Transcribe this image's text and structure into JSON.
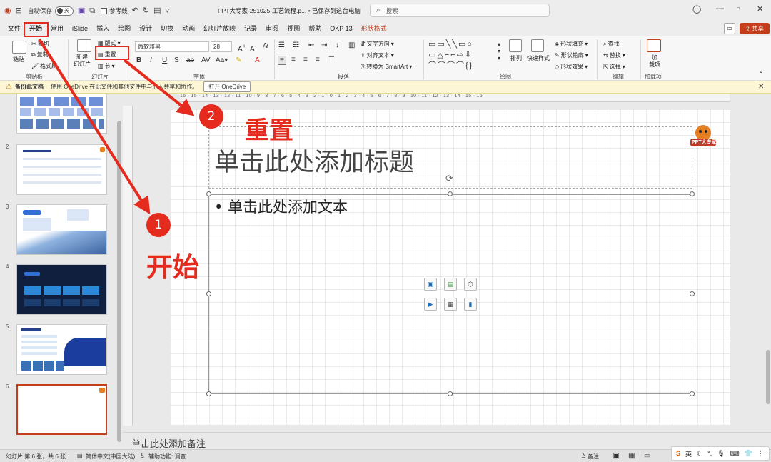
{
  "titlebar": {
    "autosave_label": "自动保存",
    "autosave_state": "关",
    "ref_mode_label": "参考线",
    "doc_title": "PPT大专家-251025-工艺流程.p... • 已保存到这台电脑",
    "search_placeholder": "搜索"
  },
  "tabs": [
    "文件",
    "开始",
    "常用",
    "iSlide",
    "插入",
    "绘图",
    "设计",
    "切换",
    "动画",
    "幻灯片放映",
    "记录",
    "审阅",
    "视图",
    "帮助",
    "OKP 13",
    "形状格式"
  ],
  "share_label": "共享",
  "ribbon": {
    "clipboard": {
      "paste": "粘贴",
      "cut": "剪切",
      "copy": "复制",
      "format_painter": "格式刷",
      "label": "剪贴板"
    },
    "slides": {
      "new_slide": "新建\n幻灯片",
      "layout": "版式",
      "reset": "重置",
      "section": "节",
      "label": "幻灯片"
    },
    "font": {
      "font_name": "微软雅黑",
      "font_size": "28",
      "label": "字体"
    },
    "paragraph": {
      "text_direction": "文字方向",
      "align_text": "对齐文本",
      "smartart": "转换为 SmartArt",
      "label": "段落"
    },
    "drawing": {
      "arrange": "排列",
      "quick_styles": "快速样式",
      "shape_fill": "形状填充",
      "shape_outline": "形状轮廓",
      "shape_effects": "形状效果",
      "label": "绘图"
    },
    "editing": {
      "find": "查找",
      "replace": "替换",
      "select": "选择",
      "label": "编辑"
    },
    "addins": {
      "addin": "加\n载项",
      "label": "加载项"
    }
  },
  "notification": {
    "title": "备份此文档",
    "message": "使用 OneDrive 在此文件和其他文件中与他人共享和协作。",
    "button": "打开 OneDrive"
  },
  "thumbnails": [
    {
      "num": "",
      "kind": "blue-grid"
    },
    {
      "num": "2",
      "kind": "table"
    },
    {
      "num": "3",
      "kind": "mountain"
    },
    {
      "num": "4",
      "kind": "dark"
    },
    {
      "num": "5",
      "kind": "mixed"
    },
    {
      "num": "6",
      "kind": "blank",
      "selected": true
    }
  ],
  "slide": {
    "title_placeholder": "单击此处添加标题",
    "body_placeholder": "• 单击此处添加文本",
    "logo_text": "PPT大专家"
  },
  "notes_placeholder": "单击此处添加备注",
  "status": {
    "slide_info": "幻灯片 第 6 张，共 6 张",
    "language": "简体中文(中国大陆)",
    "accessibility": "辅助功能: 调查",
    "notes": "备注",
    "ime": "英"
  },
  "annotations": {
    "step1_num": "1",
    "step1_text": "开始",
    "step2_num": "2",
    "step2_text": "重置"
  },
  "ruler_labels": "16 · 15 · 14 · 13 · 12 · 11 · 10 · 9 · 8 · 7 · 6 · 5 · 4 · 3 · 2 · 1 · 0 · 1 · 2 · 3 · 4 · 5 · 6 · 7 · 8 · 9 · 10 · 11 · 12 · 13 · 14 · 15 · 16",
  "colors": {
    "accent": "#c43e1c",
    "annotation_red": "#e42b1e"
  }
}
